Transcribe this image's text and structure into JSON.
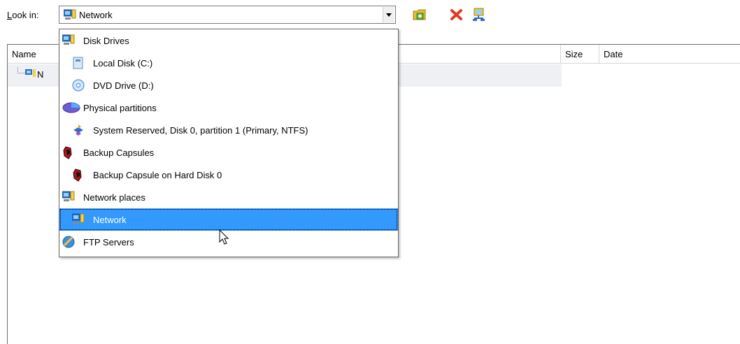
{
  "look_in": {
    "label_prefix": "L",
    "label_rest": "ook in:",
    "value": "Network"
  },
  "toolbar": {
    "new_folder_icon": "folder-add-icon",
    "delete_icon": "delete-icon",
    "network_icon": "network-computer-icon"
  },
  "list": {
    "columns": {
      "name": "Name",
      "size": "Size",
      "date": "Date"
    },
    "tree_item": {
      "label": "N"
    }
  },
  "dropdown": {
    "items": [
      {
        "label": "Disk Drives",
        "icon": "network-computer-icon",
        "level": 0
      },
      {
        "label": "Local Disk (C:)",
        "icon": "disk-icon",
        "level": 1
      },
      {
        "label": "DVD Drive (D:)",
        "icon": "dvd-icon",
        "level": 1
      },
      {
        "label": "Physical partitions",
        "icon": "partitions-icon",
        "level": 0
      },
      {
        "label": "System Reserved, Disk 0, partition 1 (Primary, NTFS)",
        "icon": "partition-icon",
        "level": 1
      },
      {
        "label": "Backup Capsules",
        "icon": "capsule-icon",
        "level": 0
      },
      {
        "label": "Backup Capsule on Hard Disk 0",
        "icon": "capsule-icon",
        "level": 1
      },
      {
        "label": "Network places",
        "icon": "network-computer-icon",
        "level": 0
      },
      {
        "label": "Network",
        "icon": "network-computer-icon",
        "level": 1,
        "selected": true
      },
      {
        "label": "FTP Servers",
        "icon": "ftp-globe-icon",
        "level": 0
      }
    ]
  },
  "colors": {
    "selection": "#3399ff",
    "header_border": "#d6d6d6"
  }
}
